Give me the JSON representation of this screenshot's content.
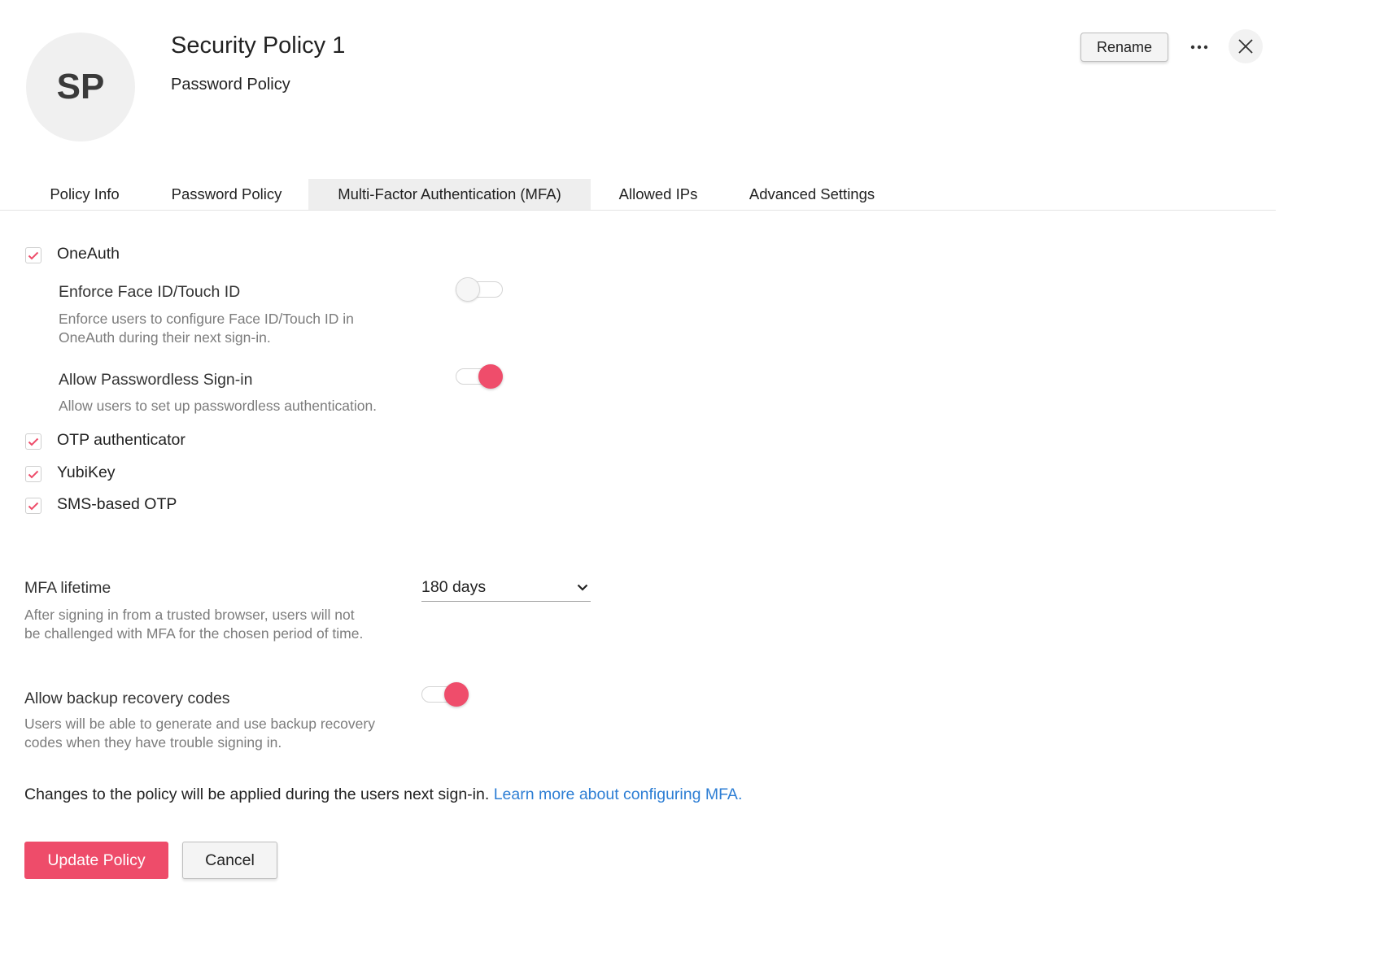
{
  "header": {
    "avatar_initials": "SP",
    "title": "Security Policy 1",
    "subtitle": "Password Policy",
    "rename_label": "Rename",
    "more_icon": "more-horizontal-icon",
    "close_icon": "close-icon"
  },
  "tabs": [
    {
      "label": "Policy Info",
      "active": false
    },
    {
      "label": "Password Policy",
      "active": false
    },
    {
      "label": "Multi-Factor Authentication (MFA)",
      "active": true
    },
    {
      "label": "Allowed IPs",
      "active": false
    },
    {
      "label": "Advanced Settings",
      "active": false
    }
  ],
  "methods": {
    "oneauth": {
      "label": "OneAuth",
      "checked": true
    },
    "otp": {
      "label": "OTP authenticator",
      "checked": true
    },
    "yubikey": {
      "label": "YubiKey",
      "checked": true
    },
    "sms": {
      "label": "SMS-based OTP",
      "checked": true
    }
  },
  "oneauth_options": {
    "face_id": {
      "title": "Enforce Face ID/Touch ID",
      "desc_line1": "Enforce users to configure Face ID/Touch ID in",
      "desc_line2": "OneAuth during their next sign-in.",
      "enabled": false
    },
    "passwordless": {
      "title": "Allow Passwordless Sign-in",
      "desc_line1": "Allow users to set up passwordless authentication.",
      "enabled": true
    }
  },
  "mfa_lifetime": {
    "title": "MFA lifetime",
    "desc_line1": "After signing in from a trusted browser, users will not",
    "desc_line2": "be challenged with MFA for the chosen period of time.",
    "selected": "180 days"
  },
  "backup_codes": {
    "title": "Allow backup recovery codes",
    "desc_line1": "Users will be able to generate and use backup recovery",
    "desc_line2": "codes when they have trouble signing in.",
    "enabled": true
  },
  "footer": {
    "note": "Changes to the policy will be applied during the users next sign-in.",
    "link": "Learn more about configuring MFA.",
    "update_label": "Update Policy",
    "cancel_label": "Cancel"
  },
  "colors": {
    "accent": "#ee4c6a",
    "link": "#2d7ed4"
  }
}
